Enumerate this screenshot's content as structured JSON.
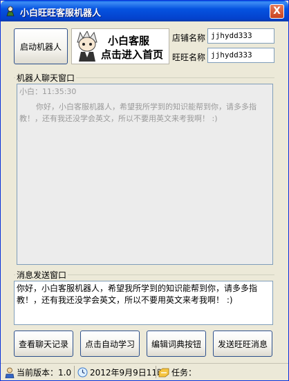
{
  "window": {
    "title": "小白旺旺客服机器人",
    "close_label": "X"
  },
  "top": {
    "start_robot_label": "启动机器人",
    "banner": {
      "line1": "小白客服",
      "line2": "点击进入首页"
    },
    "shop_name_label": "店铺名称",
    "shop_name_value": "jjhydd333",
    "wangwang_name_label": "旺旺名称",
    "wangwang_name_value": "jjhydd333"
  },
  "chat": {
    "group_label": "机器人聊天窗口",
    "sender_time": "小白：11:35:30",
    "message": "你好，小白客服机器人，希望我所学到的知识能帮到你，请多多指教！，还有我还没学会英文，所以不要用英文来考我啊！ :)"
  },
  "send": {
    "group_label": "消息发送窗口",
    "input_value": "你好，小白客服机器人，希望我所学到的知识能帮到你，请多多指教！，还有我还没学会英文，所以不要用英文来考我啊！ :)"
  },
  "buttons": {
    "view_history": "查看聊天记录",
    "auto_learn": "点击自动学习",
    "edit_dictionary": "编辑词典按钮",
    "send_message": "发送旺旺消息"
  },
  "status": {
    "version": "当前版本：1.0",
    "datetime": "2012年9月9日11时",
    "task": "任务："
  },
  "colors": {
    "titlebar": "#0553e0",
    "window_bg": "#ece9d8",
    "chat_bg": "#ececec",
    "input_border": "#7f9db9"
  }
}
